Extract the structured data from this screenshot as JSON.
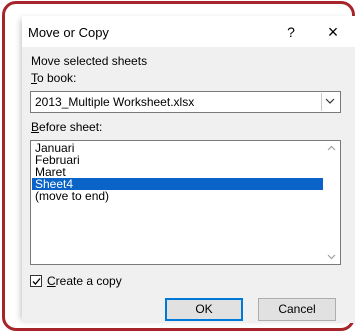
{
  "dialog": {
    "title": "Move or Copy",
    "help_label": "?",
    "close_label": "×",
    "heading": "Move selected sheets",
    "to_book_label_mnemonic": "T",
    "to_book_label_rest": "o book:",
    "to_book_value": "2013_Multiple Worksheet.xlsx",
    "before_sheet_label_mnemonic": "B",
    "before_sheet_label_rest": "efore sheet:",
    "sheets": [
      "Januari",
      "Februari",
      "Maret",
      "Sheet4",
      "(move to end)"
    ],
    "selected_sheet": "Sheet4",
    "create_copy_mnemonic": "C",
    "create_copy_rest": "reate a copy",
    "create_copy_checked": true,
    "ok_label": "OK",
    "cancel_label": "Cancel"
  },
  "colors": {
    "frame_border": "#a6242a",
    "selection": "#0a64c8",
    "dialog_bg": "#f0f0f0"
  }
}
